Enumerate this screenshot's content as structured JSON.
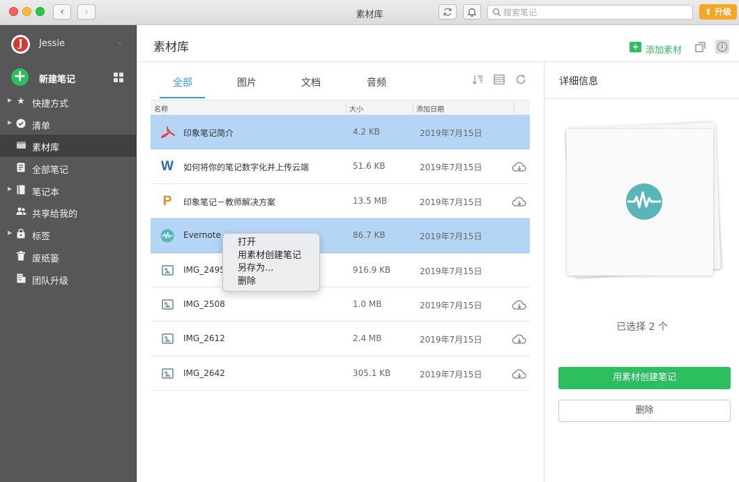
{
  "window": {
    "title": "素材库",
    "search_placeholder": "搜索笔记",
    "upgrade_label": "升级"
  },
  "sidebar": {
    "account_name": "Jessie",
    "avatar_letter": "J",
    "new_note_label": "新建笔记",
    "items": [
      {
        "label": "快捷方式",
        "icon": "star-icon",
        "expandable": true
      },
      {
        "label": "清单",
        "icon": "checkmark-icon",
        "expandable": true
      },
      {
        "label": "素材库",
        "icon": "tray-icon",
        "expandable": false,
        "selected": true
      },
      {
        "label": "全部笔记",
        "icon": "note-icon",
        "expandable": false
      },
      {
        "label": "笔记本",
        "icon": "notebook-icon",
        "expandable": true
      },
      {
        "label": "共享给我的",
        "icon": "people-icon",
        "expandable": false
      },
      {
        "label": "标签",
        "icon": "tag-icon",
        "expandable": true
      },
      {
        "label": "废纸篓",
        "icon": "trash-icon",
        "expandable": false
      },
      {
        "label": "团队升级",
        "icon": "building-icon",
        "expandable": false
      }
    ]
  },
  "main": {
    "title": "素材库",
    "add_material_label": "添加素材",
    "tabs": [
      {
        "label": "全部",
        "active": true
      },
      {
        "label": "图片",
        "active": false
      },
      {
        "label": "文档",
        "active": false
      },
      {
        "label": "音频",
        "active": false
      }
    ],
    "columns": {
      "name": "名称",
      "size": "大小",
      "date": "添加日期"
    },
    "rows": [
      {
        "name": "印象笔记简介",
        "size": "4.2 KB",
        "date": "2019年7月15日",
        "icon": "pdf-icon",
        "selected": true,
        "cloud": false
      },
      {
        "name": "如何将你的笔记数字化并上传云端",
        "size": "51.6 KB",
        "date": "2019年7月15日",
        "icon": "word-icon",
        "selected": false,
        "cloud": true
      },
      {
        "name": "印象笔记－教师解决方案",
        "size": "13.5 MB",
        "date": "2019年7月15日",
        "icon": "powerpoint-icon",
        "selected": false,
        "cloud": true
      },
      {
        "name": "Evernote",
        "size": "86.7 KB",
        "date": "2019年7月15日",
        "icon": "audio-wave-icon",
        "selected": true,
        "cloud": false
      },
      {
        "name": "IMG_2495",
        "size": "916.9 KB",
        "date": "2019年7月15日",
        "icon": "image-icon",
        "selected": false,
        "cloud": false
      },
      {
        "name": "IMG_2508",
        "size": "1.0 MB",
        "date": "2019年7月15日",
        "icon": "image-icon",
        "selected": false,
        "cloud": true
      },
      {
        "name": "IMG_2612",
        "size": "2.4 MB",
        "date": "2019年7月15日",
        "icon": "image-icon",
        "selected": false,
        "cloud": true
      },
      {
        "name": "IMG_2642",
        "size": "305.1 KB",
        "date": "2019年7月15日",
        "icon": "image-icon",
        "selected": false,
        "cloud": true
      }
    ]
  },
  "context_menu": {
    "items": [
      "打开",
      "用素材创建笔记",
      "另存为...",
      "删除"
    ]
  },
  "detail": {
    "title": "详细信息",
    "selected_text": "已选择 2 个",
    "create_button": "用素材创建笔记",
    "delete_button": "删除"
  },
  "colors": {
    "accent_green": "#2dbe60",
    "tab_blue": "#2e9ce6",
    "selection_blue": "#b4d5f5",
    "upgrade_orange": "#f5a623",
    "sidebar_bg": "#575757"
  }
}
